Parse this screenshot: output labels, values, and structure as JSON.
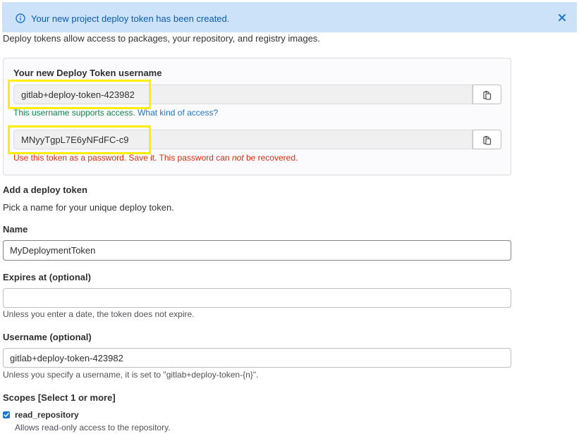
{
  "alert": {
    "message": "Your new project deploy token has been created.",
    "icon": "info-icon",
    "close_icon": "close-icon",
    "accent_color": "#1f75cb"
  },
  "intro": "Deploy tokens allow access to packages, your repository, and registry images.",
  "new_token": {
    "title": "Your new Deploy Token username",
    "username_value": "gitlab+deploy-token-423982",
    "username_help": "This username supports access.",
    "username_help_link": "What kind of access?",
    "password_value": "MNyyTgpL7E6yNFdFC-c9",
    "password_help_prefix": "Use this token as a password. Save it. This password can ",
    "password_help_em": "not",
    "password_help_suffix": " be recovered.",
    "copy_icon": "copy-icon"
  },
  "form": {
    "heading": "Add a deploy token",
    "description": "Pick a name for your unique deploy token.",
    "name_label": "Name",
    "name_value": "MyDeploymentToken",
    "expires_label": "Expires at (optional)",
    "expires_value": "",
    "expires_help": "Unless you enter a date, the token does not expire.",
    "username_label": "Username (optional)",
    "username_value": "gitlab+deploy-token-423982",
    "username_help": "Unless you specify a username, it is set to \"gitlab+deploy-token-{n}\".",
    "scopes_label": "Scopes [Select 1 or more]",
    "scopes": [
      {
        "name": "read_repository",
        "description": "Allows read-only access to the repository.",
        "checked": true
      }
    ]
  }
}
